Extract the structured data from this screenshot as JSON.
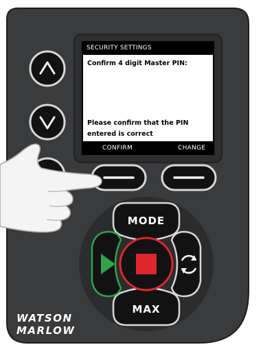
{
  "screen": {
    "header": "SECURITY SETTINGS",
    "prompt": "Confirm 4 digit Master PIN:",
    "message": "Please confirm that the PIN entered is correct",
    "softkeys": {
      "left": "CONFIRM",
      "right": "CHANGE"
    }
  },
  "keypad": {
    "mode_label": "MODE",
    "max_label": "MAX",
    "icons": {
      "up": "chevron-up-icon",
      "down": "chevron-down-icon",
      "home": "home-icon",
      "run": "play-icon",
      "stop": "stop-icon",
      "direction": "rotate-direction-icon"
    }
  },
  "brand": {
    "line1": "WATSON",
    "line2": "MARLOW"
  },
  "colors": {
    "panel": "#3a3b3d",
    "button": "#101010",
    "run_green": "#2ea34a",
    "stop_red": "#e0262d",
    "screen_bg": "#000000"
  }
}
